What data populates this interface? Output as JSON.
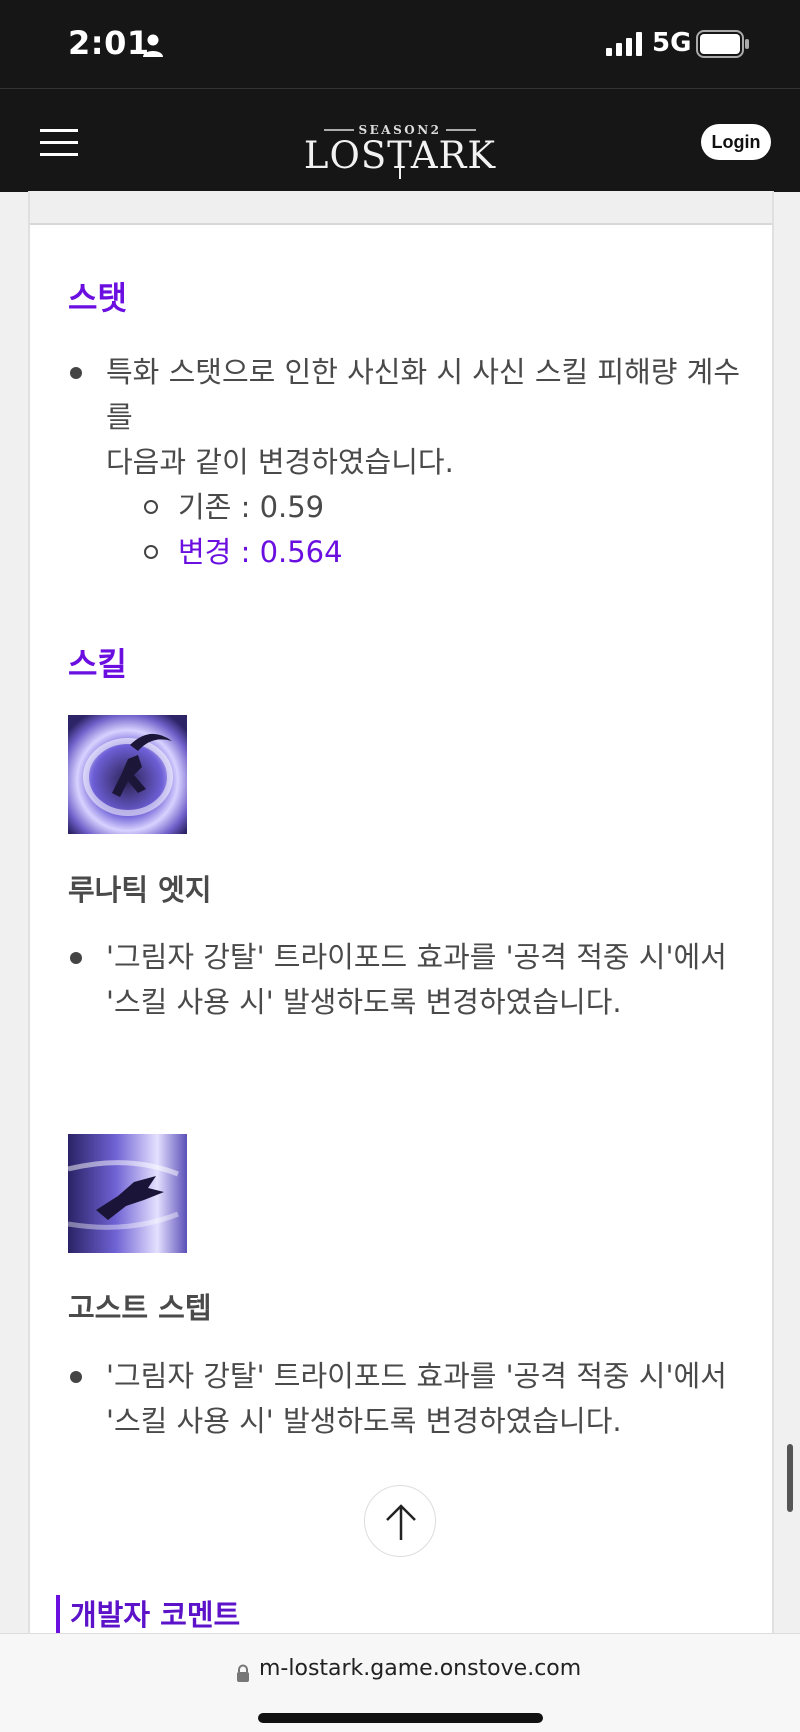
{
  "status_bar": {
    "time": "2:01",
    "network": "5G",
    "icons": [
      "person-icon",
      "signal-icon",
      "battery-icon"
    ]
  },
  "header": {
    "logo_season": "SEASON2",
    "logo_text": "LOSTARK",
    "login_label": "Login",
    "menu_icon": "hamburger-icon"
  },
  "stats_section": {
    "title": "스탯",
    "bullet_line1": "특화 스탯으로 인한 사신화 시 사신 스킬 피해량 계수를",
    "bullet_line2": "다음과 같이 변경하였습니다.",
    "sub_items": [
      {
        "text": "기존 : 0.59",
        "color": "#4a4a4a"
      },
      {
        "text": "변경 : 0.564",
        "color": "#6a0fe0"
      }
    ]
  },
  "skills_section": {
    "title": "스킬",
    "skills": [
      {
        "name": "루나틱 엣지",
        "icon": "lunatic-edge-skill-icon",
        "line1": "'그림자 강탈' 트라이포드 효과를 '공격 적중 시'에서",
        "line2": "'스킬 사용 시' 발생하도록 변경하였습니다."
      },
      {
        "name": "고스트 스텝",
        "icon": "ghost-step-skill-icon",
        "line1": "'그림자 강탈' 트라이포드 효과를 '공격 적중 시'에서",
        "line2": "'스킬 사용 시' 발생하도록 변경하였습니다."
      }
    ]
  },
  "dev_comment": {
    "title": "개발자 코멘트"
  },
  "browser": {
    "url": "m-lostark.game.onstove.com"
  },
  "colors": {
    "accent": "#6a0fe0",
    "header_bg": "#161616",
    "text": "#4a4a4a"
  }
}
